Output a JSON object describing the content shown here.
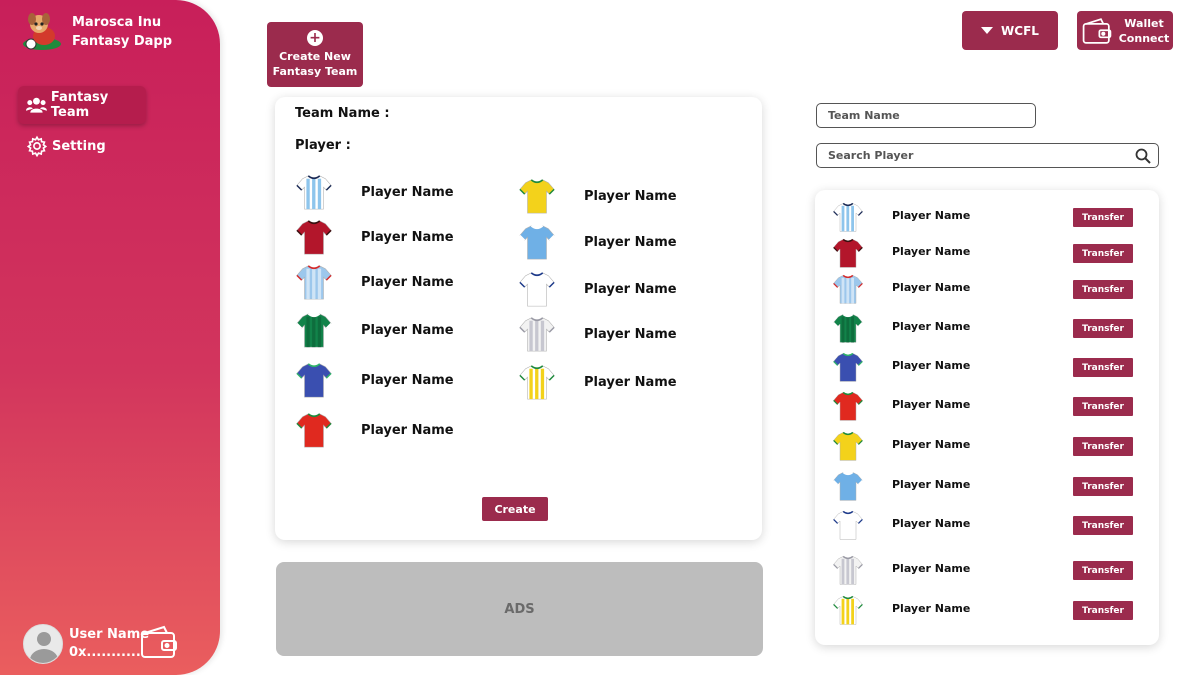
{
  "brand": {
    "line1": "Marosca Inu",
    "line2": "Fantasy Dapp"
  },
  "sidebar": {
    "items": [
      {
        "label": "Fantasy Team",
        "icon": "users-icon",
        "active": true
      },
      {
        "label": "Setting",
        "icon": "gear-icon",
        "active": false
      }
    ],
    "user": {
      "name": "User Name",
      "address": "0x..........."
    }
  },
  "header": {
    "create_new_line1": "Create New",
    "create_new_line2": "Fantasy Team",
    "token": "WCFL",
    "wallet_line1": "Wallet",
    "wallet_line2": "Connect"
  },
  "team_card": {
    "team_name_label": "Team Name :",
    "player_label": "Player :",
    "create_label": "Create",
    "players_left": [
      {
        "name": "Player Name",
        "kit": "argentina"
      },
      {
        "name": "Player Name",
        "kit": "red-dark"
      },
      {
        "name": "Player Name",
        "kit": "lightblue-pattern"
      },
      {
        "name": "Player Name",
        "kit": "green"
      },
      {
        "name": "Player Name",
        "kit": "blue-green"
      },
      {
        "name": "Player Name",
        "kit": "red-green"
      }
    ],
    "players_right": [
      {
        "name": "Player Name",
        "kit": "yellow-green"
      },
      {
        "name": "Player Name",
        "kit": "sky"
      },
      {
        "name": "Player Name",
        "kit": "white-blue"
      },
      {
        "name": "Player Name",
        "kit": "white-grey"
      },
      {
        "name": "Player Name",
        "kit": "white-tricolor"
      }
    ]
  },
  "ads_label": "ADS",
  "right": {
    "team_name_placeholder": "Team Name",
    "search_placeholder": "Search Player",
    "transfer_label": "Transfer",
    "players": [
      {
        "name": "Player Name",
        "kit": "argentina"
      },
      {
        "name": "Player Name",
        "kit": "red-dark"
      },
      {
        "name": "Player Name",
        "kit": "lightblue-pattern"
      },
      {
        "name": "Player Name",
        "kit": "green"
      },
      {
        "name": "Player Name",
        "kit": "blue-green"
      },
      {
        "name": "Player Name",
        "kit": "red-green"
      },
      {
        "name": "Player Name",
        "kit": "yellow-green"
      },
      {
        "name": "Player Name",
        "kit": "sky"
      },
      {
        "name": "Player Name",
        "kit": "white-blue"
      },
      {
        "name": "Player Name",
        "kit": "white-grey"
      },
      {
        "name": "Player Name",
        "kit": "white-tricolor"
      }
    ]
  },
  "colors": {
    "primary": "#9b2b4d",
    "sidebar_top": "#c81f5a",
    "sidebar_bottom": "#ea5e5e"
  },
  "kit_colors": {
    "argentina": {
      "body": "#ffffff",
      "stripe": "#8ec5ec",
      "trim": "#1b2a55"
    },
    "red-dark": {
      "body": "#b3162b",
      "stripe": "#b3162b",
      "trim": "#3a1010"
    },
    "lightblue-pattern": {
      "body": "#9cc7ec",
      "stripe": "#cfe4f6",
      "trim": "#d42b2b"
    },
    "green": {
      "body": "#12834a",
      "stripe": "#0e6d3d",
      "trim": "#ffffff"
    },
    "blue-green": {
      "body": "#3a4fb0",
      "stripe": "#3a4fb0",
      "trim": "#2fb36a"
    },
    "red-green": {
      "body": "#e0291f",
      "stripe": "#e0291f",
      "trim": "#1e8a3c"
    },
    "yellow-green": {
      "body": "#f3d21b",
      "stripe": "#f3d21b",
      "trim": "#1e8a3c"
    },
    "sky": {
      "body": "#6fb0e6",
      "stripe": "#6fb0e6",
      "trim": "#ffffff"
    },
    "white-blue": {
      "body": "#ffffff",
      "stripe": "#ffffff",
      "trim": "#1d3a8a"
    },
    "white-grey": {
      "body": "#f2f2f2",
      "stripe": "#c7c7d0",
      "trim": "#9a9aa5"
    },
    "white-tricolor": {
      "body": "#ffffff",
      "stripe": "#f3d21b",
      "trim": "#1e8a3c"
    }
  }
}
